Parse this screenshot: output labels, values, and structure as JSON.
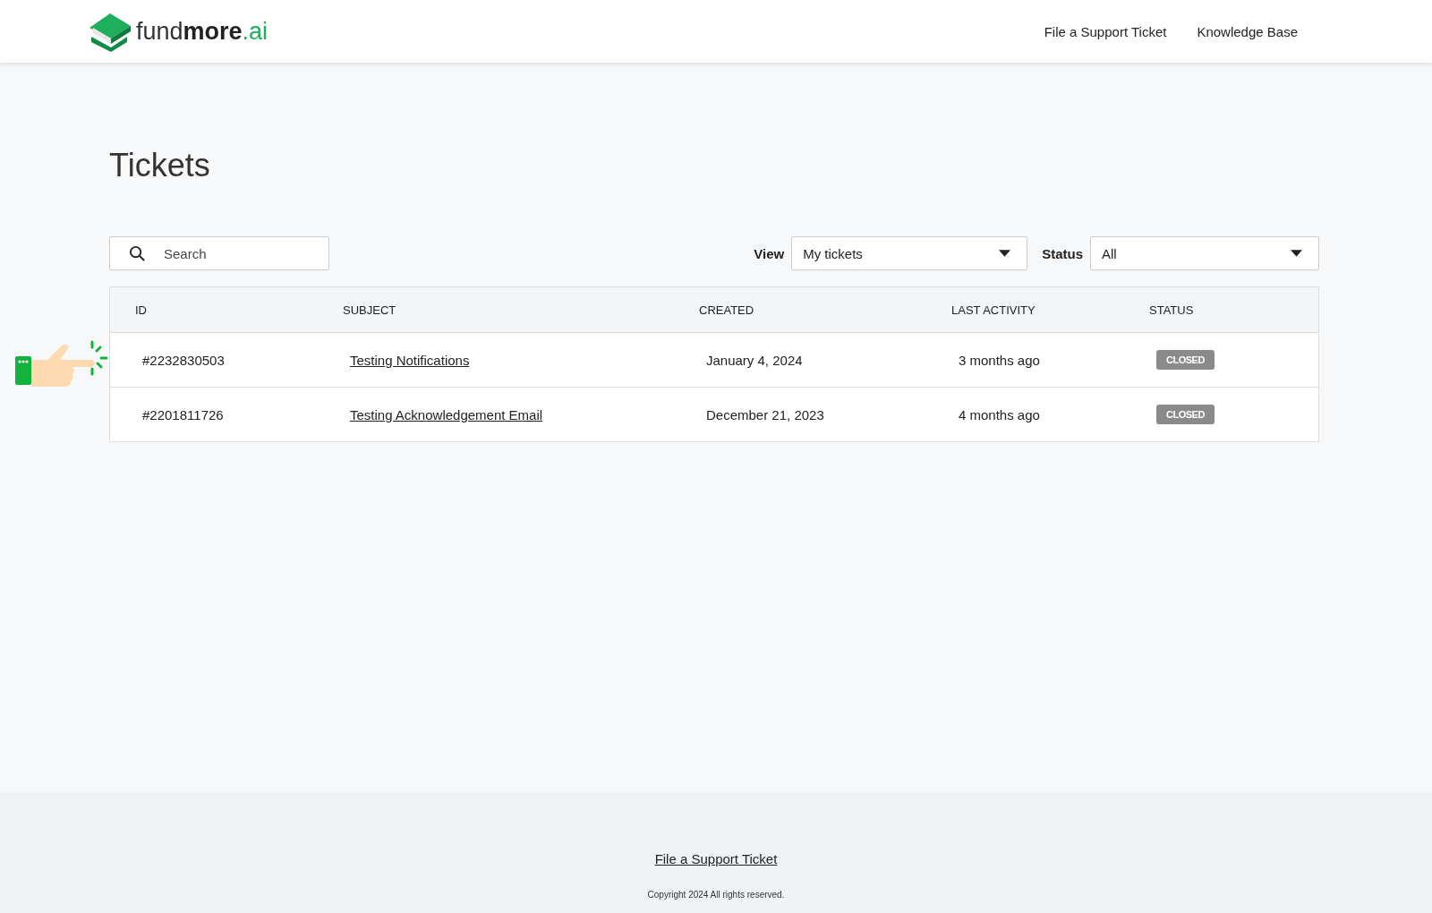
{
  "header": {
    "logo": {
      "light": "fund",
      "bold": "more",
      "suffix": ".ai"
    },
    "nav": [
      "File a Support Ticket",
      "Knowledge Base"
    ]
  },
  "page_title": "Tickets",
  "search": {
    "placeholder": "Search"
  },
  "filters": [
    {
      "label": "View",
      "value": "My tickets"
    },
    {
      "label": "Status",
      "value": "All"
    }
  ],
  "table": {
    "columns": [
      "ID",
      "SUBJECT",
      "CREATED",
      "LAST ACTIVITY",
      "STATUS"
    ],
    "rows": [
      {
        "id": "#2232830503",
        "subject": "Testing Notifications",
        "created": "January 4, 2024",
        "last_activity": "3 months ago",
        "status": "CLOSED"
      },
      {
        "id": "#2201811726",
        "subject": "Testing Acknowledgement Email",
        "created": "December 21, 2023",
        "last_activity": "4 months ago",
        "status": "CLOSED"
      }
    ]
  },
  "footer": {
    "link": "File a Support Ticket",
    "copyright": "Copyright 2024 All rights reserved."
  }
}
